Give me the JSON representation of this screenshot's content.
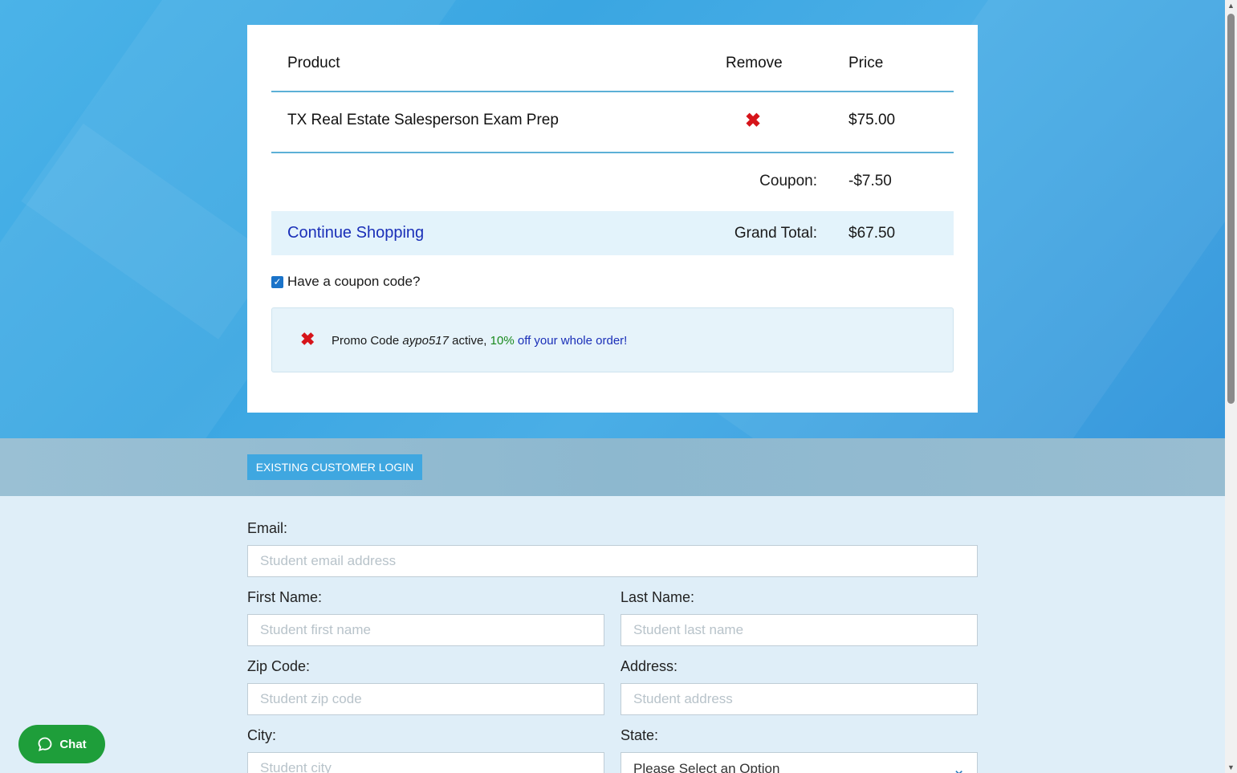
{
  "cart": {
    "headers": {
      "product": "Product",
      "remove": "Remove",
      "price": "Price"
    },
    "items": [
      {
        "name": "TX Real Estate Salesperson Exam Prep",
        "price": "$75.00"
      }
    ],
    "coupon_label": "Coupon:",
    "coupon_value": "-$7.50",
    "continue_label": "Continue Shopping",
    "grand_total_label": "Grand Total:",
    "grand_total_value": "$67.50",
    "have_coupon_label": "Have a coupon code?",
    "promo": {
      "prefix": "Promo Code",
      "code": "aypo517",
      "middle": "active,",
      "discount": "10%",
      "suffix": "off your whole order!"
    }
  },
  "login": {
    "button_label": "EXISTING CUSTOMER LOGIN"
  },
  "form": {
    "email_label": "Email:",
    "email_placeholder": "Student email address",
    "first_label": "First Name:",
    "first_placeholder": "Student first name",
    "last_label": "Last Name:",
    "last_placeholder": "Student last name",
    "zip_label": "Zip Code:",
    "zip_placeholder": "Student zip code",
    "address_label": "Address:",
    "address_placeholder": "Student address",
    "city_label": "City:",
    "city_placeholder": "Student city",
    "state_label": "State:",
    "state_selected": "Please Select an Option"
  },
  "chat": {
    "label": "Chat"
  },
  "colors": {
    "accent": "#3fa7e0",
    "remove": "#d6141a",
    "link": "#1a2fb8",
    "chat": "#1e9e3a"
  }
}
